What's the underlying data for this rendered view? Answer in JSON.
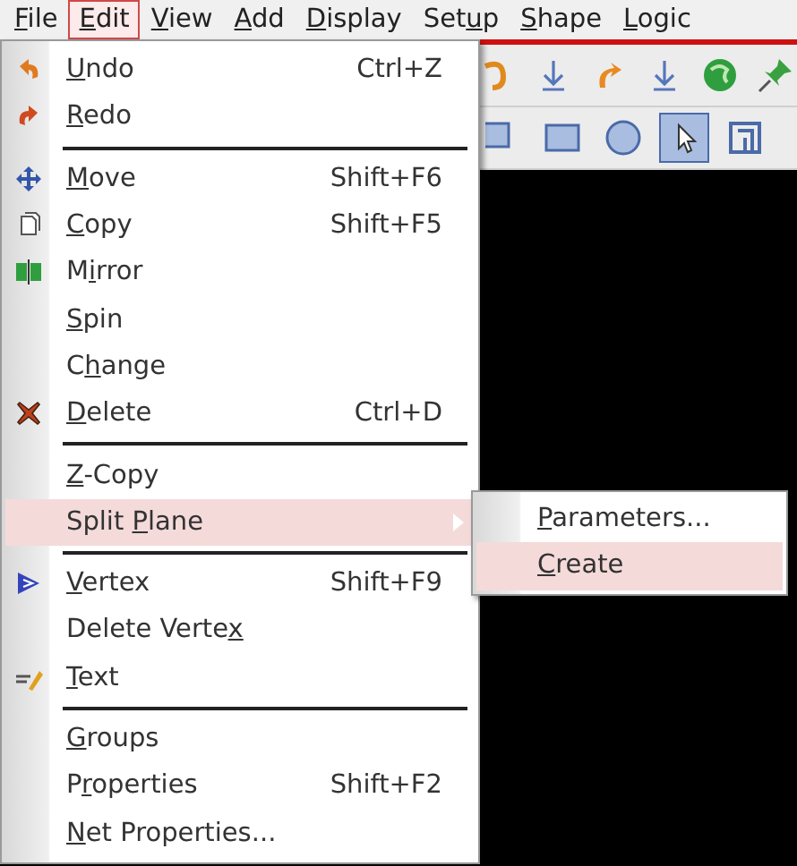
{
  "menubar": [
    {
      "label": {
        "key": "F",
        "post": "ile"
      },
      "selected": false
    },
    {
      "label": {
        "key": "E",
        "post": "dit"
      },
      "selected": true
    },
    {
      "label": {
        "key": "V",
        "post": "iew"
      },
      "selected": false
    },
    {
      "label": {
        "key": "A",
        "post": "dd"
      },
      "selected": false
    },
    {
      "label": {
        "key": "D",
        "post": "isplay"
      },
      "selected": false
    },
    {
      "label": {
        "pre": "Set",
        "key": "u",
        "post": "p"
      },
      "selected": false
    },
    {
      "label": {
        "key": "S",
        "post": "hape"
      },
      "selected": false
    },
    {
      "label": {
        "key": "L",
        "post": "ogic"
      },
      "selected": false
    }
  ],
  "toolbars": [
    [
      {
        "kind": "curve",
        "selected": false
      },
      {
        "kind": "down-arrow",
        "selected": false
      },
      {
        "kind": "redo",
        "selected": false
      },
      {
        "kind": "down-arrow",
        "selected": false
      },
      {
        "kind": "globe",
        "selected": false
      },
      {
        "kind": "pin",
        "selected": false
      }
    ],
    [
      {
        "kind": "corner",
        "selected": false
      },
      {
        "kind": "square",
        "selected": false
      },
      {
        "kind": "circle",
        "selected": false
      },
      {
        "kind": "pointer",
        "selected": true
      },
      {
        "kind": "frame",
        "selected": false
      }
    ]
  ],
  "edit_menu": [
    {
      "kind": "command",
      "label": {
        "key": "U",
        "post": "ndo"
      },
      "shortcut": "Ctrl+Z",
      "selected": false
    },
    {
      "kind": "command",
      "label": {
        "key": "R",
        "post": "edo"
      },
      "selected": false
    },
    {
      "kind": "separator"
    },
    {
      "kind": "command",
      "label": {
        "key": "M",
        "post": "ove"
      },
      "shortcut": "Shift+F6",
      "selected": false
    },
    {
      "kind": "command",
      "label": {
        "key": "C",
        "post": "opy"
      },
      "shortcut": "Shift+F5",
      "selected": false
    },
    {
      "kind": "command",
      "label": {
        "pre": "M",
        "key": "i",
        "post": "rror"
      },
      "selected": false
    },
    {
      "kind": "command",
      "label": {
        "key": "S",
        "post": "pin"
      },
      "selected": false
    },
    {
      "kind": "command",
      "label": {
        "pre": "C",
        "key": "h",
        "post": "ange"
      },
      "selected": false
    },
    {
      "kind": "command",
      "label": {
        "key": "D",
        "post": "elete"
      },
      "shortcut": "Ctrl+D",
      "selected": false
    },
    {
      "kind": "separator"
    },
    {
      "kind": "command",
      "label": {
        "key": "Z",
        "post": "-Copy"
      },
      "selected": false
    },
    {
      "kind": "command",
      "label": {
        "pre": "Split ",
        "key": "P",
        "post": "lane"
      },
      "selected": true,
      "submenu": [
        {
          "label": {
            "key": "P",
            "post": "arameters..."
          },
          "selected": false
        },
        {
          "label": {
            "key": "C",
            "post": "reate"
          },
          "selected": true
        }
      ]
    },
    {
      "kind": "separator"
    },
    {
      "kind": "command",
      "label": {
        "key": "V",
        "post": "ertex"
      },
      "shortcut": "Shift+F9",
      "selected": false
    },
    {
      "kind": "command",
      "label": {
        "pre": "Delete Verte",
        "key": "x"
      },
      "selected": false
    },
    {
      "kind": "command",
      "label": {
        "key": "T",
        "post": "ext"
      },
      "selected": false
    },
    {
      "kind": "separator"
    },
    {
      "kind": "command",
      "label": {
        "key": "G",
        "post": "roups"
      },
      "selected": false
    },
    {
      "kind": "command",
      "label": {
        "pre": "P",
        "key": "r",
        "post": "operties"
      },
      "shortcut": "Shift+F2",
      "selected": false
    },
    {
      "kind": "command",
      "label": {
        "key": "N",
        "post": "et Properties..."
      },
      "selected": false
    }
  ]
}
